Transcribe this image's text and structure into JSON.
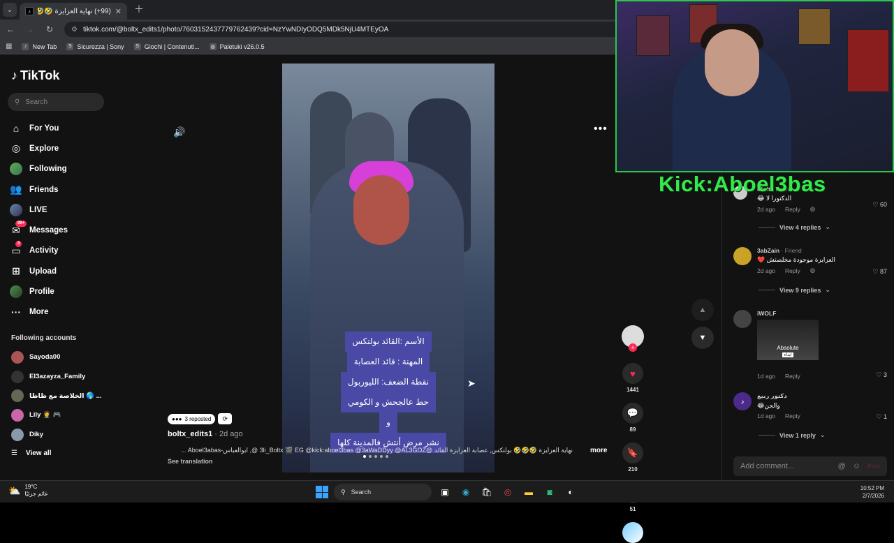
{
  "browser": {
    "tab_title": "(99+) نهاية العزايزة 🤣🤣🤣 القا",
    "url": "tiktok.com/@boltx_edits1/photo/7603152437779762439?cid=NzYwNDIyODQ5MDk5NjU4MTEyOA",
    "bookmarks": [
      "New Tab",
      "Sicurezza | Sony",
      "Giochi | Contenuti...",
      "Paletuki v26.0.5"
    ]
  },
  "sidebar": {
    "logo": "TikTok",
    "search_placeholder": "Search",
    "items": [
      {
        "label": "For You",
        "icon": "home-icon"
      },
      {
        "label": "Explore",
        "icon": "compass-icon"
      },
      {
        "label": "Following",
        "icon": "following-icon"
      },
      {
        "label": "Friends",
        "icon": "friends-icon"
      },
      {
        "label": "LIVE",
        "icon": "live-icon"
      },
      {
        "label": "Messages",
        "icon": "messages-icon",
        "badge": "99+"
      },
      {
        "label": "Activity",
        "icon": "activity-icon",
        "badge": "3"
      },
      {
        "label": "Upload",
        "icon": "upload-icon"
      },
      {
        "label": "Profile",
        "icon": "profile-icon"
      },
      {
        "label": "More",
        "icon": "more-icon"
      }
    ],
    "following_title": "Following accounts",
    "following": [
      "Sayoda00",
      "El3azayza_Family",
      "الخلاصة مع ظاظا 🌎 ...",
      "Lily 🤵 🎮",
      "Diky"
    ],
    "view_all": "View all"
  },
  "post": {
    "caption_lines": [
      "الأسم :القائد بولتكس",
      "المهنة : قائد العصابة",
      "نقطة الضعف: الليوربول",
      "حط عالجحش و الكومي",
      "و",
      "نشر مرض أنتش فالمدينة كلها"
    ],
    "reposted": "3 reposted",
    "username": "boltx_edits1",
    "time": " · 2d ago",
    "description": "نهاية العزايزة 🤣🤣🤣 بولتكس, عصابة العزايزة القائد @3li_Boltx 🎬 EG @kick:aboel3bas @3aWaDDyy @AL3GOZ @, ابوالعباس-Aboel3abas ...",
    "more": "more",
    "see_translation": "See translation",
    "likes": "1441",
    "comments": "89",
    "saves": "210",
    "shares": "51"
  },
  "comments": [
    {
      "name": "iBolt",
      "tag": " · Friend",
      "text": "الدكتورا لا 😂",
      "time": "2d ago",
      "likes": "60",
      "replies": "View 4 replies"
    },
    {
      "name": "3abZain",
      "tag": " · Friend",
      "text": "العزايزة موجودة مخلصتش ❤️",
      "time": "2d ago",
      "likes": "87",
      "replies": "View 9 replies"
    },
    {
      "name": "iWOLF",
      "tag": "",
      "text": "",
      "gif_text": "Absolute",
      "gif_sub": "ابداء",
      "time": "1d ago",
      "likes": "3",
      "replies": ""
    },
    {
      "name": "دكتور ربيع",
      "tag": "",
      "text": "والجن😂",
      "time": "1d ago",
      "likes": "1",
      "replies": "View 1 reply"
    }
  ],
  "comment_reply_label": "Reply",
  "add_comment_placeholder": "Add comment...",
  "post_label": "Post",
  "overlay": {
    "kick_text": "Kick:Aboel3bas"
  },
  "taskbar": {
    "temperature": "19°C",
    "weather_desc": "غائم جزئيًا",
    "search": "Search",
    "time": "10:52 PM",
    "date": "2/7/2026"
  },
  "colors": {
    "accent": "#fe2c55",
    "kick_green": "#33e94b",
    "caption_bg": "#4a4aa6"
  }
}
